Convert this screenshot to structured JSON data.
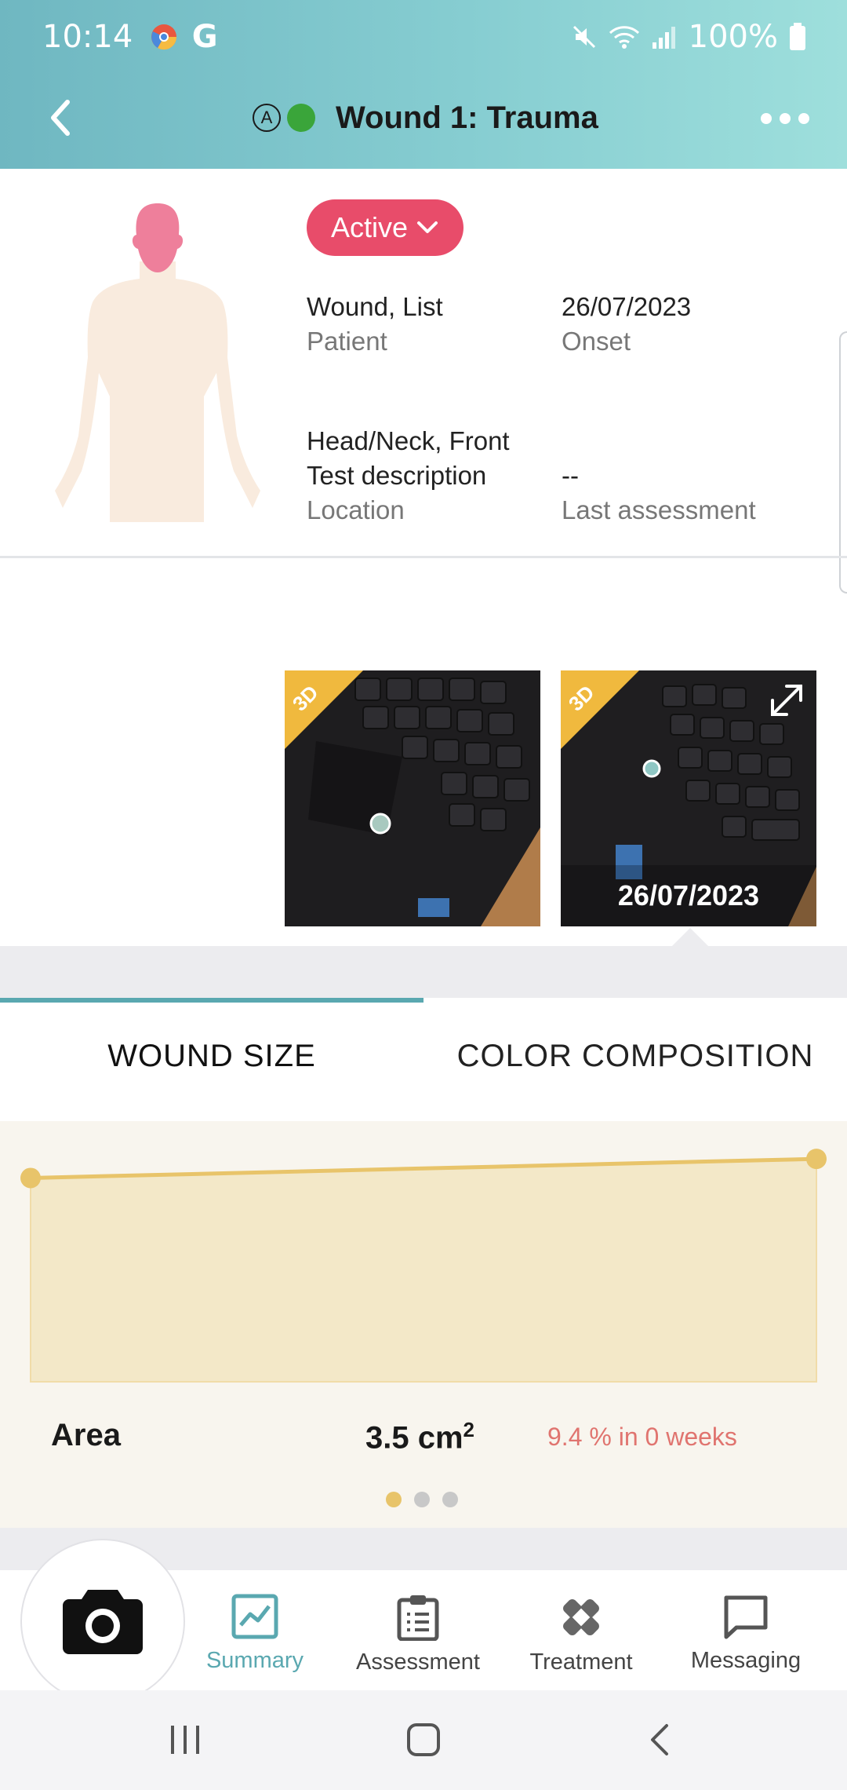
{
  "status_bar": {
    "time": "10:14",
    "g_label": "G",
    "battery": "100%"
  },
  "app_bar": {
    "title": "Wound 1: Trauma",
    "a_badge": "A",
    "status_dot_color": "#3aa53a"
  },
  "wound": {
    "status": "Active",
    "patient_value": "Wound, List",
    "patient_label": "Patient",
    "onset_value": "26/07/2023",
    "onset_label": "Onset",
    "location_line1": "Head/Neck, Front",
    "location_line2": "Test description",
    "location_label": "Location",
    "last_assessment_value": "--",
    "last_assessment_label": "Last assessment"
  },
  "photos": [
    {
      "badge": "3D",
      "date": ""
    },
    {
      "badge": "3D",
      "date": "26/07/2023"
    }
  ],
  "tabs": {
    "wound_size": "WOUND SIZE",
    "color_composition": "COLOR COMPOSITION",
    "active": "wound_size"
  },
  "metric": {
    "label": "Area",
    "value": "3.5 cm",
    "unit_sup": "2",
    "change": "9.4 % in 0 weeks"
  },
  "pager": {
    "pages": 3,
    "active": 1
  },
  "chart_data": {
    "type": "area",
    "series": [
      {
        "values": [
          3.2,
          3.5
        ]
      }
    ],
    "ylim": [
      0,
      3.6
    ],
    "color": "#e8c46a",
    "fill": "#f3e8c8"
  },
  "bottom_nav": {
    "items": [
      {
        "label": "Summary",
        "icon": "chart-icon",
        "active": true
      },
      {
        "label": "Assessment",
        "icon": "clipboard-icon",
        "active": false
      },
      {
        "label": "Treatment",
        "icon": "bandage-icon",
        "active": false
      },
      {
        "label": "Messaging",
        "icon": "chat-icon",
        "active": false
      }
    ],
    "camera_icon": "camera-icon"
  },
  "colors": {
    "accent": "#5aa8b0",
    "status_active": "#e84c6a",
    "change_text": "#e0746f",
    "chart_line": "#e8c46a"
  }
}
